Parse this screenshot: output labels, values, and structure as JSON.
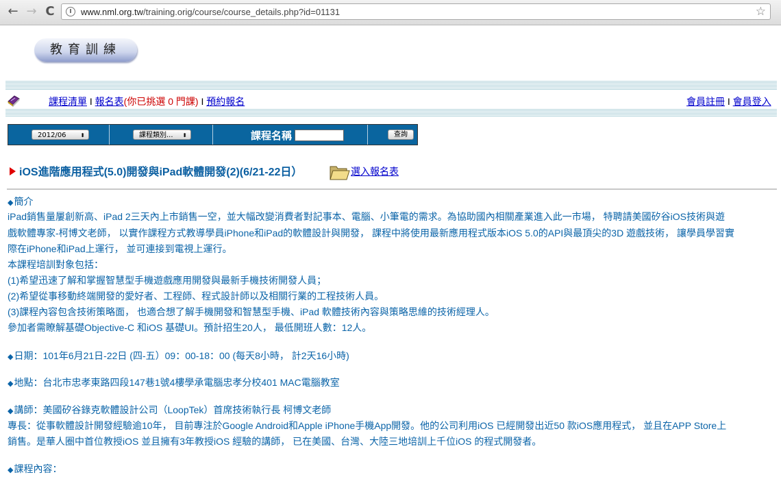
{
  "browser": {
    "url_prefix": "www.nml.org.tw",
    "url_path": "/training.orig/course/course_details.php?id=01131",
    "back": "←",
    "forward": "→",
    "reload": "C",
    "star": "☆"
  },
  "logo": {
    "text": "教育訓練"
  },
  "nav": {
    "course_list": "課程清單",
    "sep1": "I",
    "signup_form": "報名表",
    "selected_prefix": "(你已挑選 ",
    "selected_count": "0",
    "selected_suffix": " 門課)",
    "sep2": "I",
    "reserve": "預約報名",
    "register": "會員註冊",
    "sep3": "I",
    "login": "會員登入"
  },
  "search": {
    "date_value": "2012/06",
    "category_value": "課程類別...",
    "name_label": "課程名稱",
    "button": "查詢"
  },
  "course": {
    "title": "iOS進階應用程式(5.0)開發與iPad軟體開發(2)(6/21-22日）",
    "enroll_link": "選入報名表"
  },
  "content": {
    "intro_heading": "簡介",
    "intro_l1": "iPad銷售量屢創新高、iPad 2三天內上市銷售一空，並大幅改變消費者對記事本、電腦、小筆電的需求。為協助國內相關產業進入此一市場， 特聘請美國矽谷iOS技術與遊",
    "intro_l2": "戲軟體專家-柯博文老師， 以實作課程方式教導學員iPhone和iPad的軟體設計與開發， 課程中將使用最新應用程式版本iOS 5.0的API與最頂尖的3D 遊戲技術， 讓學員學習實",
    "intro_l3": "際在iPhone和iPad上運行， 並可連接到電視上運行。",
    "target_heading": "本課程培訓對象包括：",
    "target_1": "(1)希望迅速了解和掌握智慧型手機遊戲應用開發與最新手機技術開發人員；",
    "target_2": "(2)希望從事移動終端開發的愛好者、工程師、程式設計師以及相關行業的工程技術人員。",
    "target_3": "(3)課程內容包含技術策略面， 也適合想了解手機開發和智慧型手機、iPad 軟體技術內容與策略思維的技術經理人。",
    "prereq": "參加者需瞭解基礎Objective-C 和iOS 基礎UI。預計招生20人， 最低開班人數：12人。",
    "date": "日期：101年6月21日-22日 (四-五）09：00-18：00 (每天8小時， 計2天16小時)",
    "location": "地點：台北市忠孝東路四段147巷1號4樓學承電腦忠孝分校401 MAC電腦教室",
    "teacher": "講師：美國矽谷錄克軟體設計公司（LoopTek）首席技術執行長 柯博文老師",
    "expertise_l1": "專長：從事軟體設計開發經驗逾10年， 目前專注於Google Android和Apple iPhone手機App開發。他的公司利用iOS 已經開發出近50 款iOS應用程式， 並且在APP Store上",
    "expertise_l2": "銷售。是華人圈中首位教授iOS 並且擁有3年教授iOS 經驗的講師， 已在美國、台灣、大陸三地培訓上千位iOS 的程式開發者。",
    "syllabus_heading": "課程內容："
  },
  "colors": {
    "content_blue": "#0b64a8",
    "link_blue": "#0000cc",
    "bar_blue": "#0a659f",
    "alert_red": "#cc0000"
  }
}
